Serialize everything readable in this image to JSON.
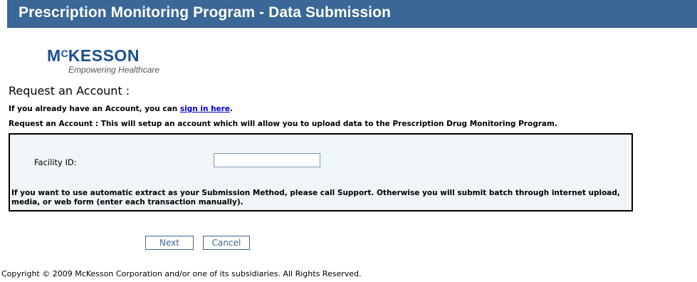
{
  "header": {
    "title": "Prescription Monitoring Program - Data Submission"
  },
  "logo": {
    "brand_prefix": "M",
    "brand_sup": "C",
    "brand_rest": "KESSON",
    "tagline": "Empowering Healthcare"
  },
  "page": {
    "heading": "Request an Account :",
    "signin_prefix": "If you already have an Account, you can ",
    "signin_link": "sign in here",
    "signin_suffix": ".",
    "description": "Request an Account : This will setup an account which will allow you to upload data to the Prescription Drug Monitoring Program."
  },
  "form": {
    "facility_label": "Facility ID:",
    "facility_value": "",
    "note": "If you want to use automatic extract as your Submission Method, please call Support. Otherwise you will submit batch through internet upload, media, or web form (enter each transaction manually)."
  },
  "buttons": {
    "next_label": "Next",
    "cancel_label": "Cancel"
  },
  "footer": {
    "copyright": "Copyright © 2009 McKesson Corporation and/or one of its subsidiaries. All Rights Reserved."
  },
  "colors": {
    "header_bg": "#3a6795",
    "brand": "#1d4f91",
    "link": "#0000cc",
    "form_bg": "#f0f5f8"
  }
}
